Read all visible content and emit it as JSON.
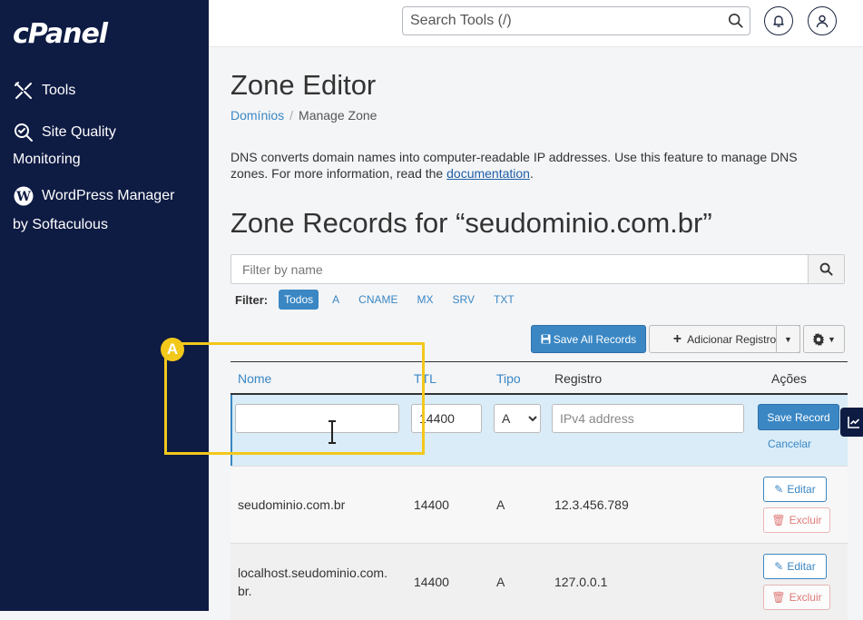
{
  "app": {
    "logo": "cPanel"
  },
  "sidebar": {
    "items": [
      {
        "label": "Tools",
        "icon": "tools-icon"
      },
      {
        "label_line1": "Site Quality",
        "label_line2": "Monitoring",
        "icon": "site-quality-icon"
      },
      {
        "label_line1": "WordPress Manager",
        "label_line2": "by Softaculous",
        "icon": "wordpress-icon"
      }
    ]
  },
  "header": {
    "search_placeholder": "Search Tools (/)",
    "icons": [
      "search-icon",
      "bell-icon",
      "user-icon"
    ]
  },
  "page": {
    "title": "Zone Editor",
    "breadcrumb": {
      "parent": "Domínios",
      "current": "Manage Zone"
    },
    "description": "DNS converts domain names into computer-readable IP addresses. Use this feature to manage DNS zones. For more information, read the",
    "description_link": "documentation",
    "description_end": ".",
    "zone_title": "Zone Records for “seudominio.com.br”"
  },
  "filter": {
    "placeholder": "Filter by name",
    "label": "Filter:",
    "types": [
      "Todos",
      "A",
      "CNAME",
      "MX",
      "SRV",
      "TXT"
    ],
    "active": "Todos"
  },
  "toolbar": {
    "save_all": "Save All Records",
    "add_record": "Adicionar Registro"
  },
  "table": {
    "headers": {
      "name": "Nome",
      "ttl": "TTL",
      "type": "Tipo",
      "record": "Registro",
      "actions": "Ações"
    },
    "edit_row": {
      "name_value": "",
      "ttl_value": "14400",
      "type_value": "A",
      "record_placeholder": "IPv4 address",
      "save_label": "Save Record",
      "cancel_label": "Cancelar"
    },
    "rows": [
      {
        "name": "seudominio.com.br",
        "ttl": "14400",
        "type": "A",
        "record": "12.3.456.789",
        "edit": "Editar",
        "delete": "Excluir"
      },
      {
        "name_line1": "localhost.seudominio.com.",
        "name_line2": "br.",
        "ttl": "14400",
        "type": "A",
        "record": "127.0.0.1",
        "edit": "Editar",
        "delete": "Excluir"
      }
    ]
  },
  "annotation": {
    "badge": "A",
    "color": "#f2c81b"
  },
  "colors": {
    "sidebar": "#0e1b43",
    "accent": "#3a87c4",
    "danger": "#d9534f",
    "edit_row_bg": "#d9ecf7"
  }
}
